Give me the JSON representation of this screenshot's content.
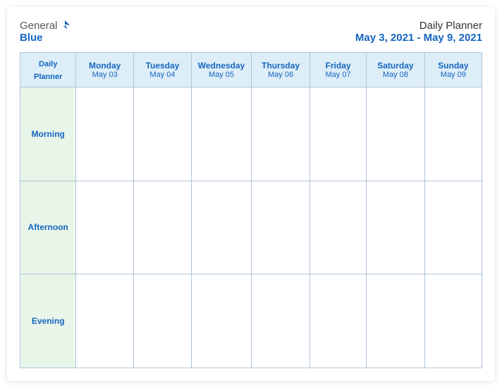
{
  "header": {
    "logo": {
      "general": "General",
      "blue": "Blue",
      "bird_alt": "bird logo"
    },
    "title": "Daily Planner",
    "dates": "May 3, 2021 - May 9, 2021"
  },
  "table": {
    "header_cell": {
      "line1": "Daily",
      "line2": "Planner"
    },
    "days": [
      {
        "name": "Monday",
        "date": "May 03"
      },
      {
        "name": "Tuesday",
        "date": "May 04"
      },
      {
        "name": "Wednesday",
        "date": "May 05"
      },
      {
        "name": "Thursday",
        "date": "May 06"
      },
      {
        "name": "Friday",
        "date": "May 07"
      },
      {
        "name": "Saturday",
        "date": "May 08"
      },
      {
        "name": "Sunday",
        "date": "May 09"
      }
    ],
    "rows": [
      {
        "label": "Morning"
      },
      {
        "label": "Afternoon"
      },
      {
        "label": "Evening"
      }
    ]
  }
}
